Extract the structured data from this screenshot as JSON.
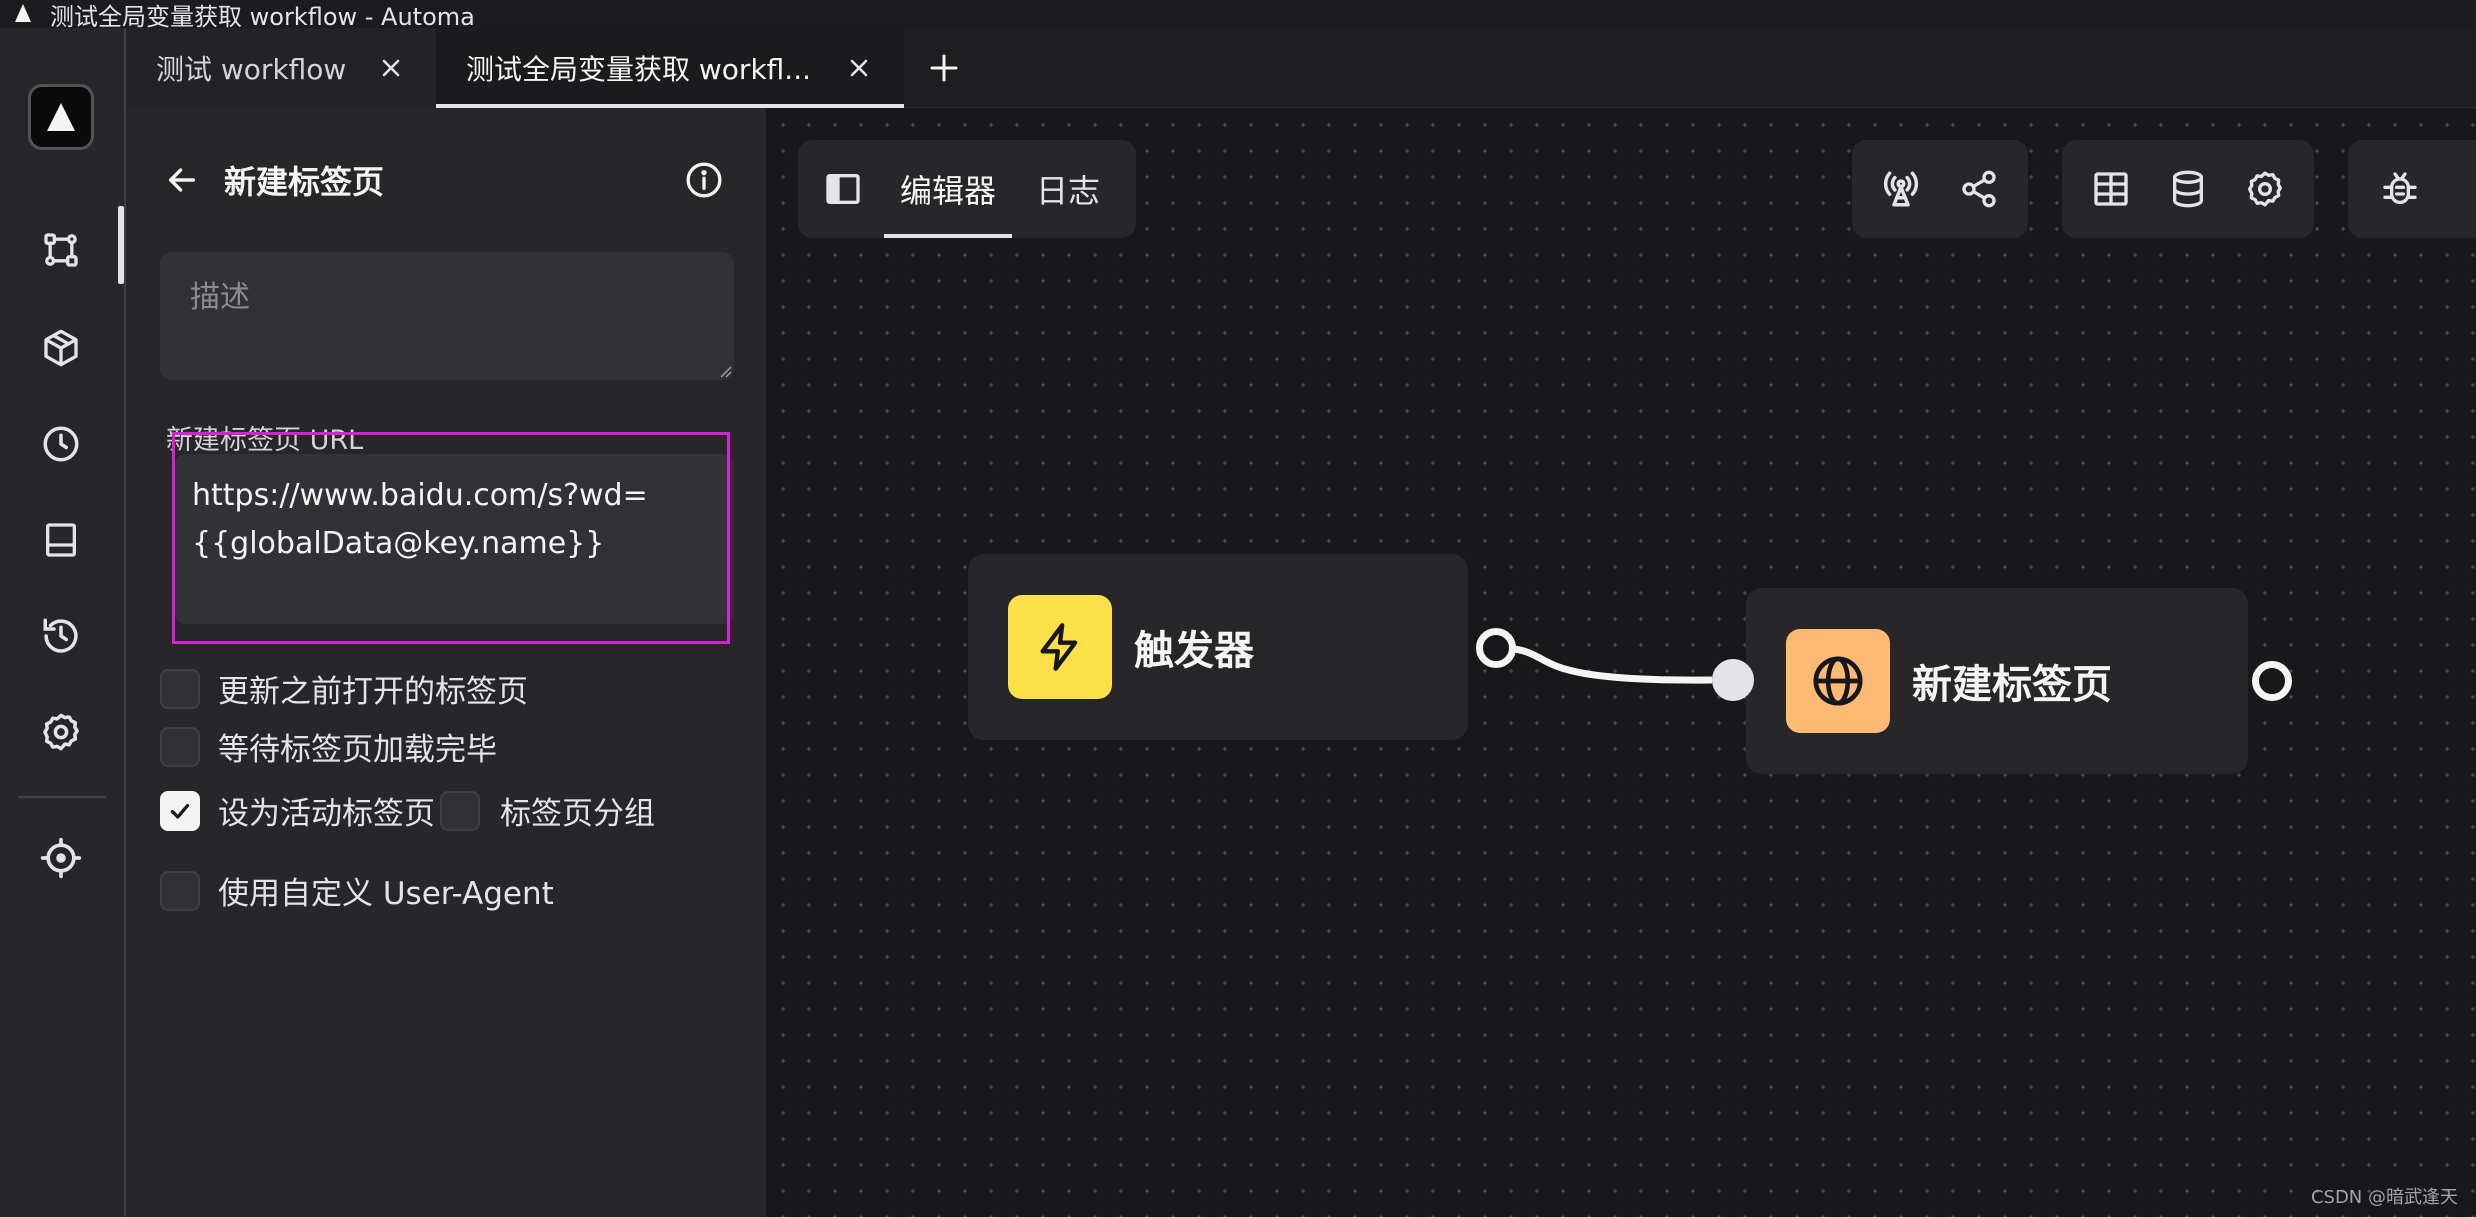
{
  "window": {
    "title": "测试全局变量获取 workflow - Automa"
  },
  "rail": {
    "items": [
      {
        "name": "workflows",
        "icon": "flow-icon",
        "active": true
      },
      {
        "name": "packages",
        "icon": "cube-icon"
      },
      {
        "name": "schedule",
        "icon": "clock-icon"
      },
      {
        "name": "storage",
        "icon": "drawer-icon"
      },
      {
        "name": "logs",
        "icon": "history-icon"
      },
      {
        "name": "settings",
        "icon": "gear-icon"
      },
      {
        "name": "element-picker",
        "icon": "crosshair-icon"
      }
    ]
  },
  "tabs": [
    {
      "label": "测试 workflow",
      "active": false
    },
    {
      "label": "测试全局变量获取 workfl...",
      "active": true
    }
  ],
  "panel": {
    "title": "新建标签页",
    "description_placeholder": "描述",
    "url_label": "新建标签页 URL",
    "url_value": "https://www.baidu.com/s?wd=\n{{globalData@key.name}}",
    "options": {
      "update_prev_tab": {
        "label": "更新之前打开的标签页",
        "checked": false
      },
      "wait_tab_loaded": {
        "label": "等待标签页加载完毕",
        "checked": false
      },
      "set_active_tab": {
        "label": "设为活动标签页",
        "checked": true
      },
      "tab_group": {
        "label": "标签页分组",
        "checked": false
      },
      "custom_user_agent": {
        "label": "使用自定义 User-Agent",
        "checked": false
      }
    }
  },
  "editor": {
    "tabs": [
      {
        "label": "编辑器",
        "active": true
      },
      {
        "label": "日志",
        "active": false
      }
    ]
  },
  "nodes": [
    {
      "id": "trigger",
      "title": "触发器",
      "icon": "bolt-icon",
      "color": "#fde047"
    },
    {
      "id": "new-tab",
      "title": "新建标签页",
      "icon": "globe-icon",
      "color": "#fdba74"
    }
  ],
  "watermark": "CSDN @暗武逢天",
  "colors": {
    "highlight": "#d622d6",
    "background": "#18181b",
    "panel": "#27272a"
  }
}
